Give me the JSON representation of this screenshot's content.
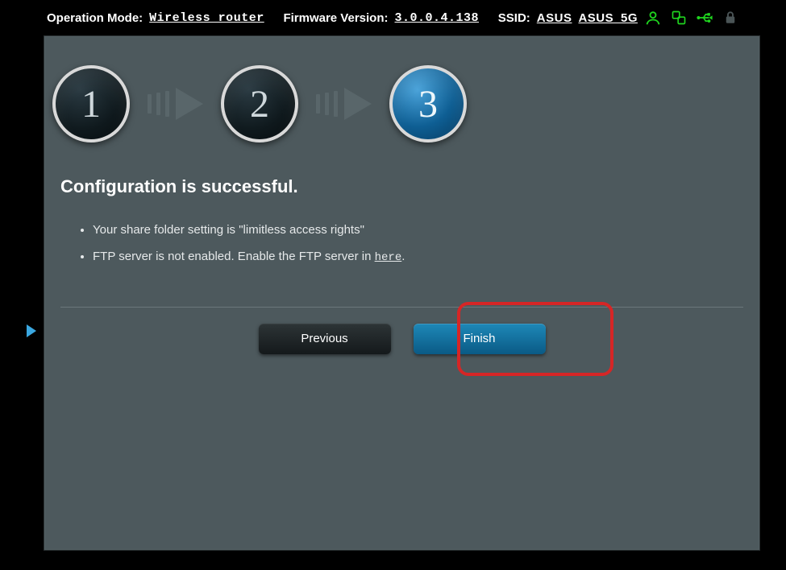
{
  "header": {
    "operation_mode_label": "Operation Mode:",
    "operation_mode_value": "Wireless router",
    "firmware_label": "Firmware Version:",
    "firmware_value": "3.0.0.4.138",
    "ssid_label": "SSID:",
    "ssid_value_1": "ASUS",
    "ssid_value_2": "ASUS_5G"
  },
  "steps": {
    "s1": "1",
    "s2": "2",
    "s3": "3"
  },
  "content": {
    "title": "Configuration is successful.",
    "bullet1": "Your share folder setting is \"limitless access rights\"",
    "bullet2_pre": "FTP server is not enabled. Enable the FTP server in ",
    "bullet2_link": "here",
    "bullet2_post": "."
  },
  "actions": {
    "previous": "Previous",
    "finish": "Finish"
  }
}
